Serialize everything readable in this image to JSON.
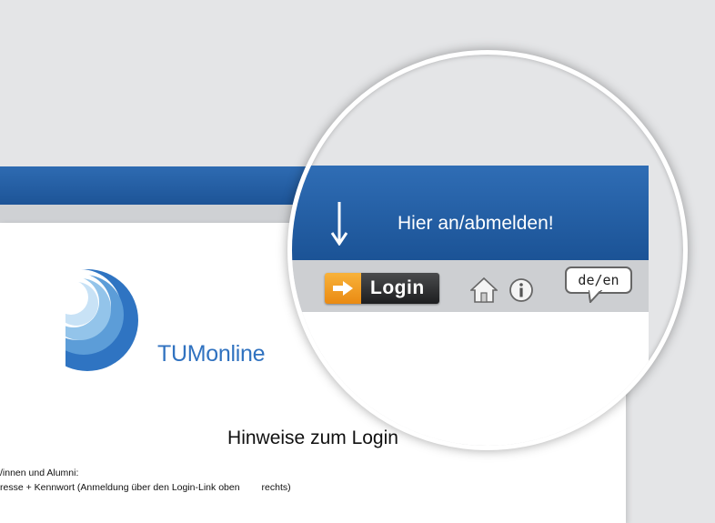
{
  "brand": {
    "name": "TUMonline"
  },
  "page": {
    "heading": "Hinweise zum Login",
    "line1": "/innen und Alumni:",
    "line2_a": "resse + Kennwort (Anmeldung über den Login-Link oben",
    "line2_b": "rechts)"
  },
  "magnifier": {
    "hint": "Hier an/abmelden!",
    "login_label": "Login",
    "language_toggle": "de/en",
    "icons": [
      "down-arrow-icon",
      "login-arrow-icon",
      "home-icon",
      "info-icon",
      "language-toggle-icon"
    ]
  },
  "colors": {
    "header_blue": "#1d5497",
    "brand_blue": "#3072c0",
    "login_orange": "#f0a02a",
    "login_dark": "#2a2b2d"
  }
}
